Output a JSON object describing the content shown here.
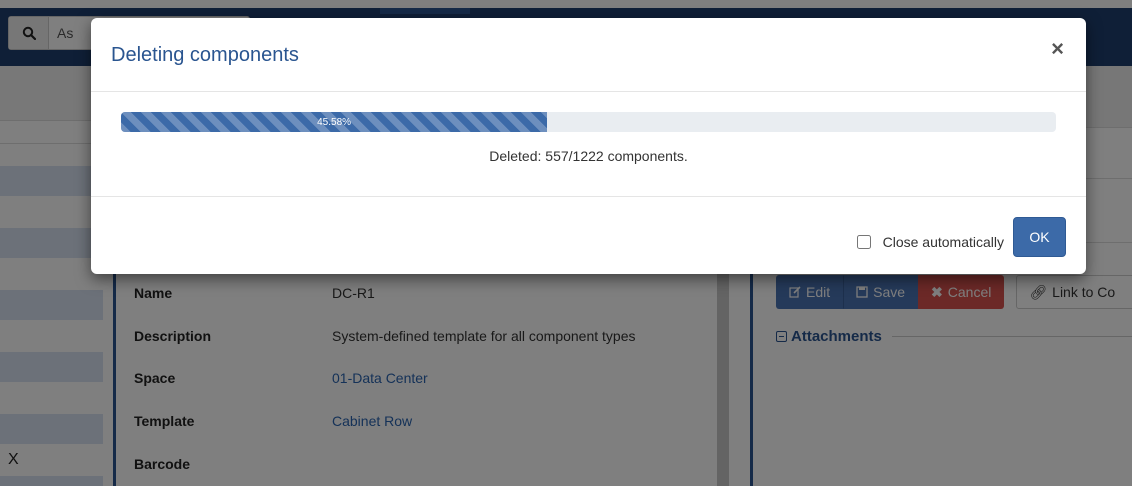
{
  "colors": {
    "primary": "#3c6aa8",
    "danger": "#d9534f",
    "overlay": "rgba(0,0,0,0.5)"
  },
  "search": {
    "text": "As",
    "icon": "search-icon"
  },
  "background_panel": {
    "left_marker": "X",
    "properties": [
      {
        "label": "Name",
        "value": "DC-R1"
      },
      {
        "label": "Description",
        "value": "System-defined template for all component types"
      },
      {
        "label": "Space",
        "value": "01-Data Center"
      },
      {
        "label": "Template",
        "value": "Cabinet Row"
      },
      {
        "label": "Barcode",
        "value": ""
      }
    ],
    "actions": {
      "edit": "Edit",
      "save": "Save",
      "cancel": "Cancel",
      "link": "Link to Co"
    },
    "attachments_title": "Attachments"
  },
  "modal": {
    "title": "Deleting components",
    "close_glyph": "×",
    "progress_percent": 45.58,
    "progress_label": "45.58%",
    "status_text": "Deleted: 557/1222 components.",
    "auto_close_label": "Close automatically",
    "auto_close_checked": false,
    "ok_label": "OK"
  }
}
